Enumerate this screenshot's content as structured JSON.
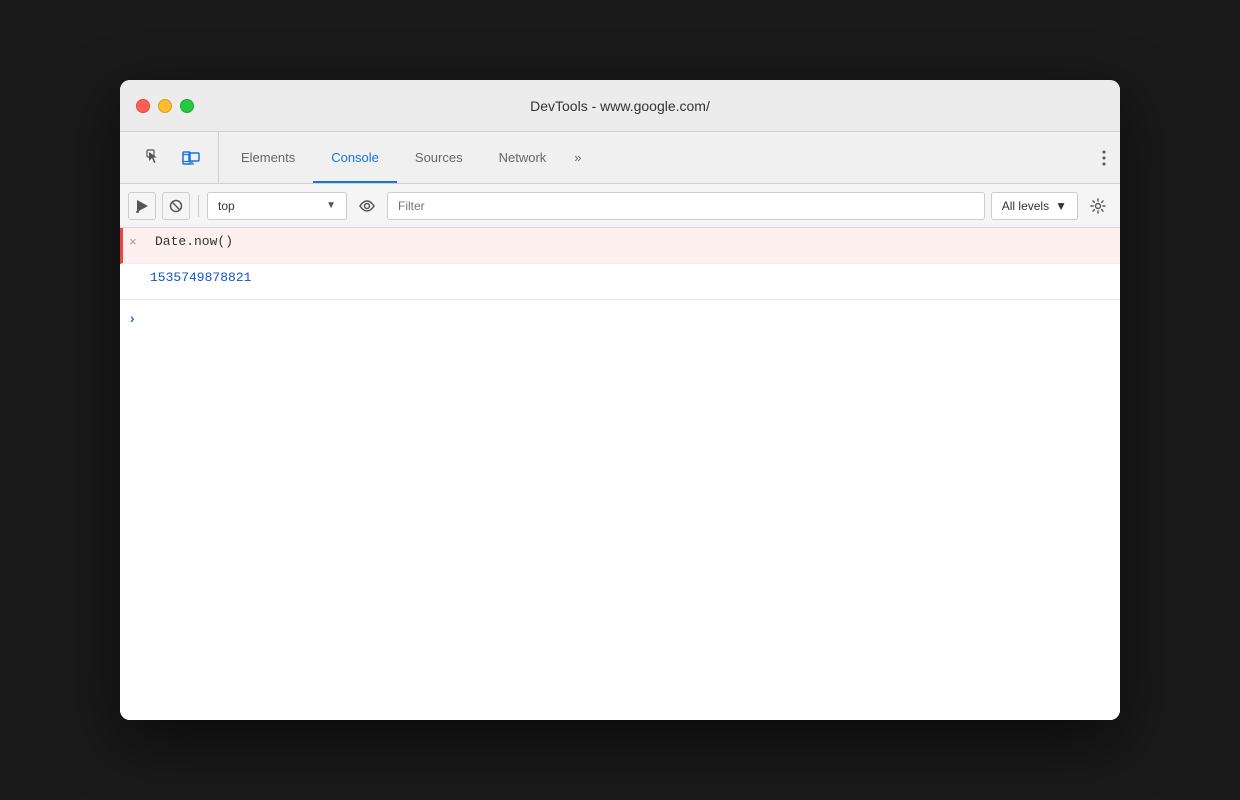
{
  "window": {
    "title": "DevTools - www.google.com/"
  },
  "traffic_lights": {
    "close_label": "close",
    "minimize_label": "minimize",
    "maximize_label": "maximize"
  },
  "tabs": [
    {
      "id": "elements",
      "label": "Elements",
      "active": false
    },
    {
      "id": "console",
      "label": "Console",
      "active": true
    },
    {
      "id": "sources",
      "label": "Sources",
      "active": false
    },
    {
      "id": "network",
      "label": "Network",
      "active": false
    },
    {
      "id": "more",
      "label": "»",
      "active": false
    }
  ],
  "console_toolbar": {
    "clear_label": "▶",
    "block_label": "🚫",
    "context_value": "top",
    "context_arrow": "▼",
    "filter_placeholder": "Filter",
    "levels_label": "All levels",
    "levels_arrow": "▼",
    "gear_icon": "⚙"
  },
  "console_entries": [
    {
      "type": "command",
      "icon": "×",
      "text": "Date.now()"
    },
    {
      "type": "result",
      "icon": "",
      "text": "1535749878821"
    }
  ],
  "console_input": {
    "prompt": ">",
    "value": ""
  }
}
